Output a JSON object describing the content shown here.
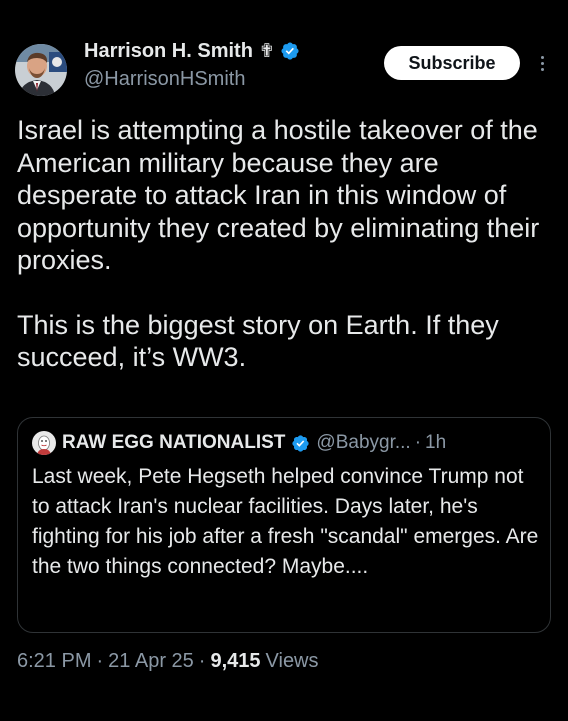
{
  "author": {
    "display_name": "Harrison H. Smith",
    "badge_emoji": "✟",
    "handle": "@HarrisonHSmith"
  },
  "subscribe_label": "Subscribe",
  "tweet": {
    "paragraphs": [
      "Israel is attempting a hostile takeover of the American military because they are desperate to attack Iran in this window of opportunity they created by eliminating their proxies.",
      "This is the biggest story on Earth. If they succeed, it’s WW3."
    ]
  },
  "quote": {
    "display_name": "RAW EGG NATIONALIST",
    "handle": "@Babygr...",
    "separator": "·",
    "time": "1h",
    "text": "Last week, Pete Hegseth helped convince Trump not to attack Iran's nuclear facilities. Days later, he's fighting for his job after a fresh \"scandal\" emerges. Are the two things connected? Maybe...."
  },
  "meta": {
    "time": "6:21 PM",
    "sep1": "·",
    "date": "21 Apr 25",
    "sep2": "·",
    "views_count": "9,415",
    "views_label": "Views"
  },
  "colors": {
    "background": "#000000",
    "text": "#e7e9ea",
    "muted": "#8b98a5",
    "verified": "#1d9bf0",
    "border": "#2f3336"
  }
}
